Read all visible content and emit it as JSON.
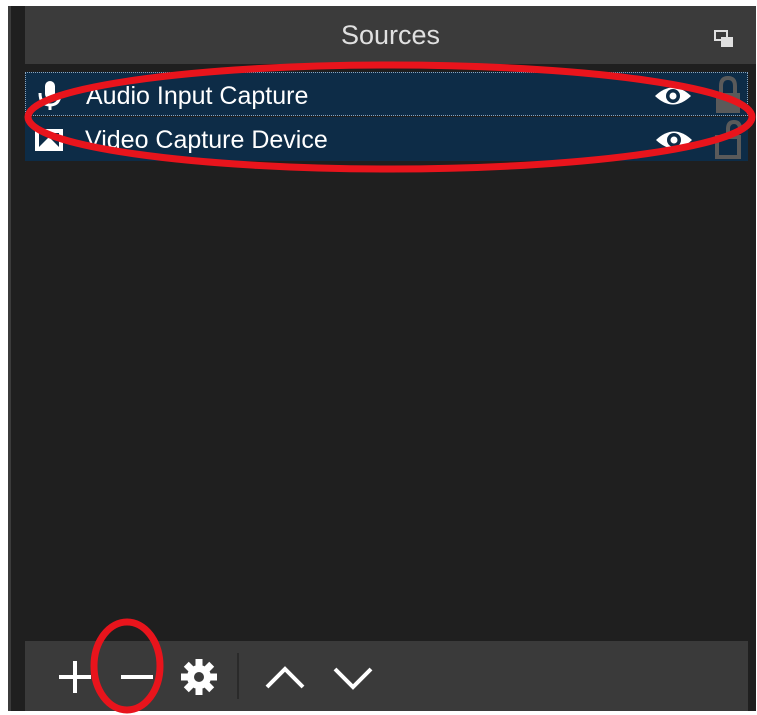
{
  "panel": {
    "title": "Sources",
    "float_icon": "dock-float-icon"
  },
  "sources": [
    {
      "label": "Audio Input Capture",
      "type_icon": "microphone-icon",
      "visible": true,
      "locked": true
    },
    {
      "label": "Video Capture Device",
      "type_icon": "camera-icon",
      "visible": true,
      "locked": false
    }
  ],
  "toolbar": {
    "buttons": [
      {
        "name": "add-source-button",
        "icon": "plus-icon"
      },
      {
        "name": "remove-source-button",
        "icon": "minus-icon"
      },
      {
        "name": "source-properties-button",
        "icon": "gear-icon"
      },
      {
        "name": "move-source-up-button",
        "icon": "chevron-up-icon"
      },
      {
        "name": "move-source-down-button",
        "icon": "chevron-down-icon"
      }
    ]
  },
  "colors": {
    "panel_bg": "#1f1f1f",
    "titlebar_bg": "#3b3b3b",
    "selection_bg": "#0d2c47",
    "annotation_red": "#e8141c"
  }
}
